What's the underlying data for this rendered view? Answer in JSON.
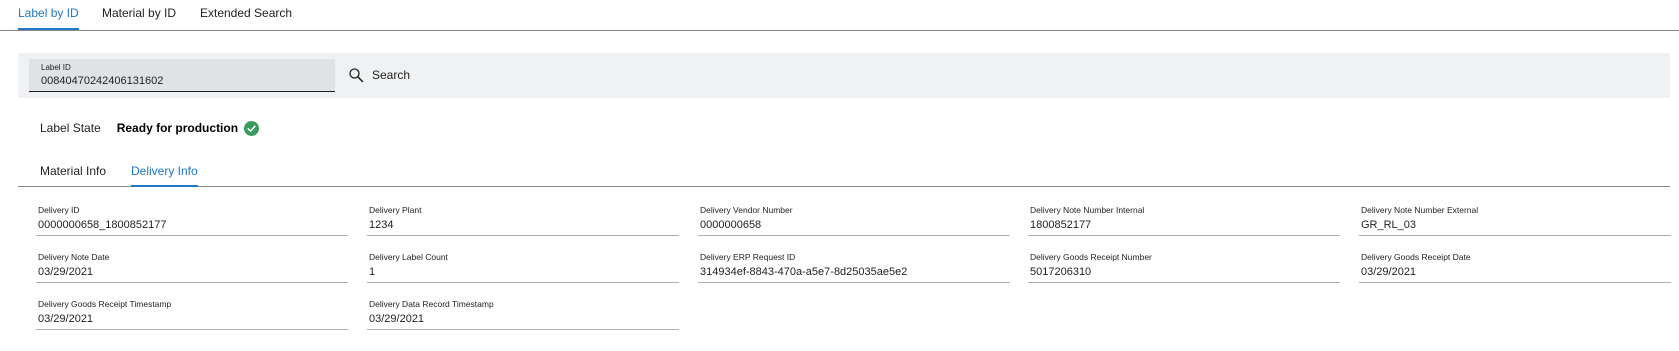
{
  "tabs": [
    "Label by ID",
    "Material by ID",
    "Extended Search"
  ],
  "search": {
    "label_id_label": "Label ID",
    "label_id_value": "00840470242406131602",
    "search_label": "Search"
  },
  "label_state": {
    "label": "Label State",
    "value": "Ready for production",
    "status_color": "#3c9a5f"
  },
  "info_tabs": [
    "Material Info",
    "Delivery Info"
  ],
  "accent_color": "#1f77c8",
  "delivery_fields": [
    {
      "label": "Delivery ID",
      "value": "0000000658_1800852177"
    },
    {
      "label": "Delivery Plant",
      "value": "1234"
    },
    {
      "label": "Delivery Vendor Number",
      "value": "0000000658"
    },
    {
      "label": "Delivery Note Number Internal",
      "value": "1800852177"
    },
    {
      "label": "Delivery Note Number External",
      "value": "GR_RL_03"
    },
    {
      "label": "Delivery Note Date",
      "value": "03/29/2021"
    },
    {
      "label": "Delivery Label Count",
      "value": "1"
    },
    {
      "label": "Delivery ERP Request ID",
      "value": "314934ef-8843-470a-a5e7-8d25035ae5e2"
    },
    {
      "label": "Delivery Goods Receipt Number",
      "value": "5017206310"
    },
    {
      "label": "Delivery Goods Receipt Date",
      "value": "03/29/2021"
    },
    {
      "label": "Delivery Goods Receipt Timestamp",
      "value": "03/29/2021"
    },
    {
      "label": "Delivery Data Record Timestamp",
      "value": "03/29/2021"
    }
  ]
}
